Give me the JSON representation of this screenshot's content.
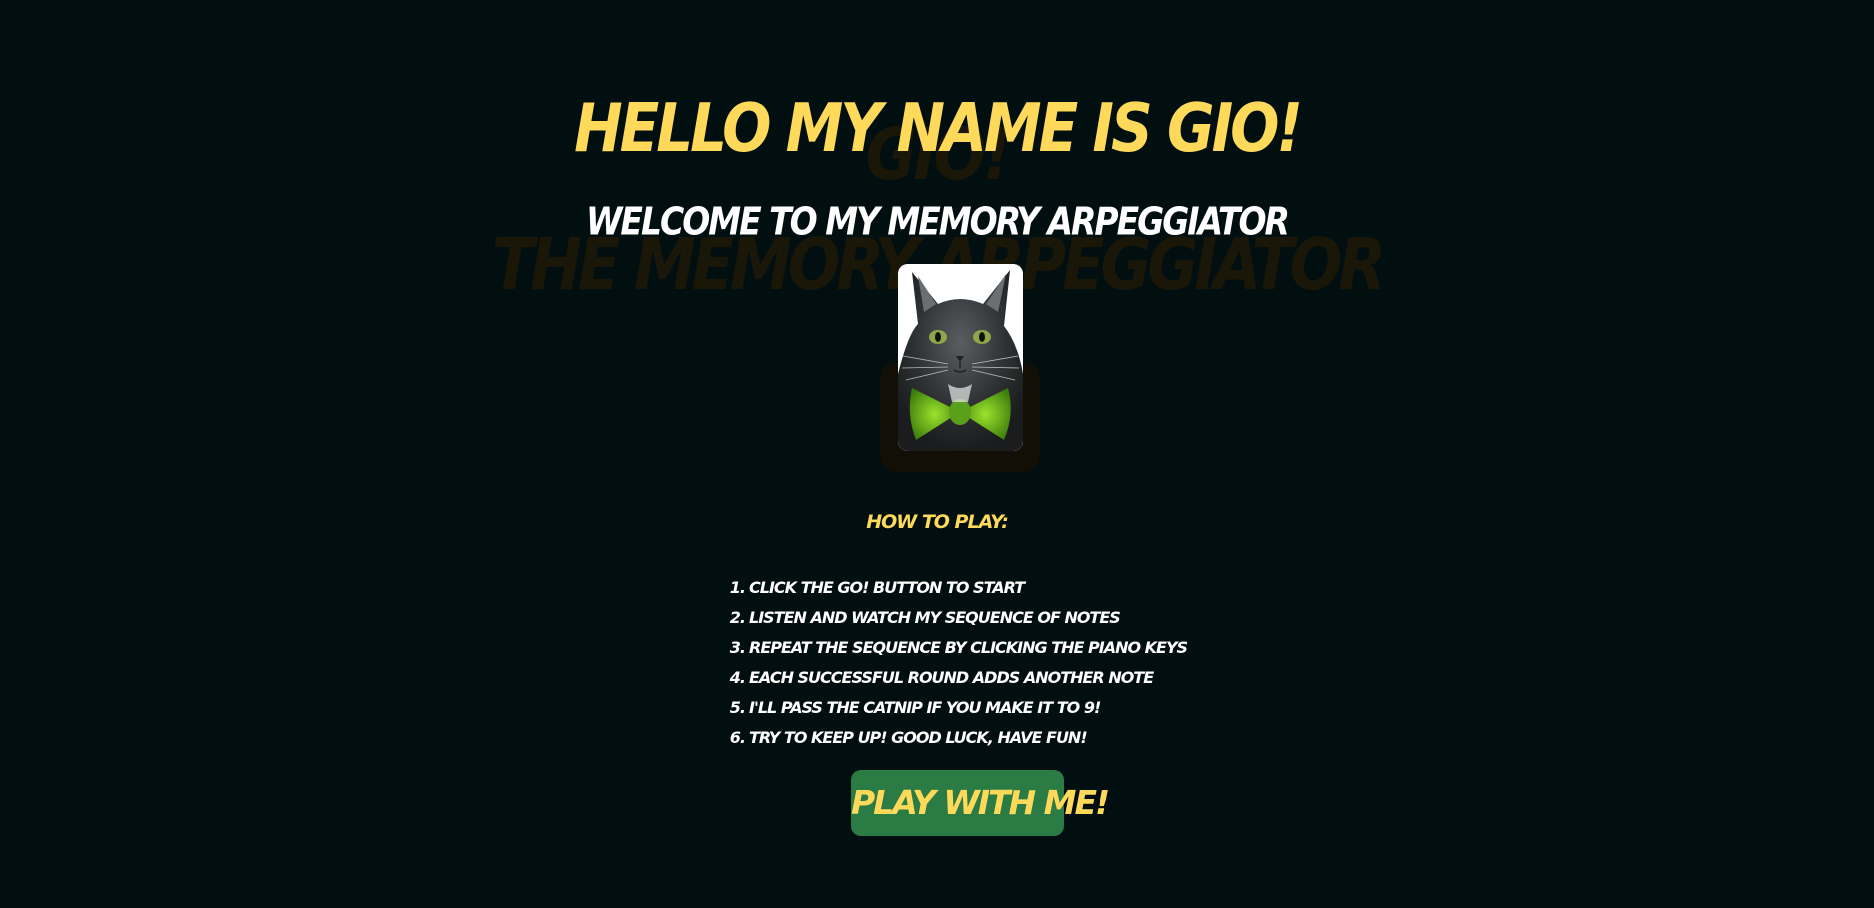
{
  "background_text": {
    "line1": "GIO!",
    "line2": "THE MEMORY ARPEGGIATOR"
  },
  "header": {
    "title": "HELLO MY NAME IS GIO!",
    "subtitle": "WELCOME TO MY MEMORY ARPEGGIATOR"
  },
  "portrait": {
    "icon": "cat-with-green-bowtie"
  },
  "instructions": {
    "heading": "HOW TO PLAY:",
    "steps": [
      {
        "num": "1.",
        "text": "CLICK THE GO! BUTTON TO START"
      },
      {
        "num": "2.",
        "text": "LISTEN AND WATCH MY SEQUENCE OF NOTES"
      },
      {
        "num": "3.",
        "text": "REPEAT THE SEQUENCE BY CLICKING THE PIANO KEYS"
      },
      {
        "num": "4.",
        "text": "EACH SUCCESSFUL ROUND ADDS ANOTHER NOTE"
      },
      {
        "num": "5.",
        "text": "I'LL PASS THE CATNIP IF YOU MAKE IT TO 9!"
      },
      {
        "num": "6.",
        "text": "TRY TO KEEP UP! GOOD LUCK, HAVE FUN!"
      }
    ]
  },
  "actions": {
    "play_label": "PLAY WITH ME!"
  },
  "colors": {
    "background": "#020f10",
    "accent_yellow": "#ffd95a",
    "button_green": "#2a7b44",
    "text_white": "#ffffff"
  }
}
